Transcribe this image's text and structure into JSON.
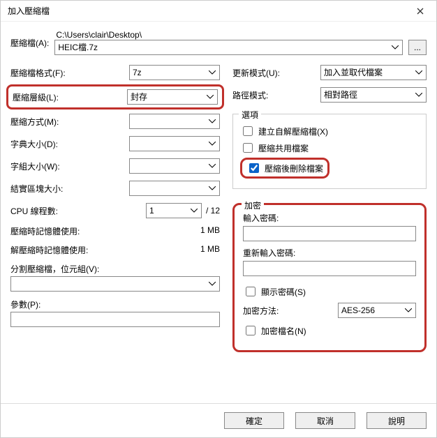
{
  "title": "加入壓縮檔",
  "archive": {
    "label": "壓縮檔(A):",
    "path": "C:\\Users\\clair\\Desktop\\",
    "value": "HEIC檔.7z",
    "browse": "..."
  },
  "left": {
    "format": {
      "label": "壓縮檔格式(F):",
      "value": "7z"
    },
    "level": {
      "label": "壓縮層級(L):",
      "value": "封存"
    },
    "method": {
      "label": "壓縮方式(M):",
      "value": ""
    },
    "dict": {
      "label": "字典大小(D):",
      "value": ""
    },
    "word": {
      "label": "字組大小(W):",
      "value": ""
    },
    "solid": {
      "label": "結實區塊大小:",
      "value": ""
    },
    "cpu": {
      "label": "CPU 線程數:",
      "value": "1",
      "total": "/ 12"
    },
    "mem_c": {
      "label": "壓縮時記憶體使用:",
      "value": "1 MB"
    },
    "mem_d": {
      "label": "解壓縮時記憶體使用:",
      "value": "1 MB"
    },
    "split": {
      "label": "分割壓縮檔，位元組(V):",
      "value": ""
    },
    "params": {
      "label": "參數(P):",
      "value": ""
    }
  },
  "right": {
    "update": {
      "label": "更新模式(U):",
      "value": "加入並取代檔案"
    },
    "path": {
      "label": "路徑模式:",
      "value": "相對路徑"
    },
    "options": {
      "legend": "選項",
      "sfx": "建立自解壓縮檔(X)",
      "share": "壓縮共用檔案",
      "del": "壓縮後刪除檔案"
    },
    "enc": {
      "legend": "加密",
      "pw1": "輸入密碼:",
      "pw2": "重新輸入密碼:",
      "show": "顯示密碼(S)",
      "method_label": "加密方法:",
      "method_value": "AES-256",
      "encnames": "加密檔名(N)"
    }
  },
  "footer": {
    "ok": "確定",
    "cancel": "取消",
    "help": "說明"
  }
}
